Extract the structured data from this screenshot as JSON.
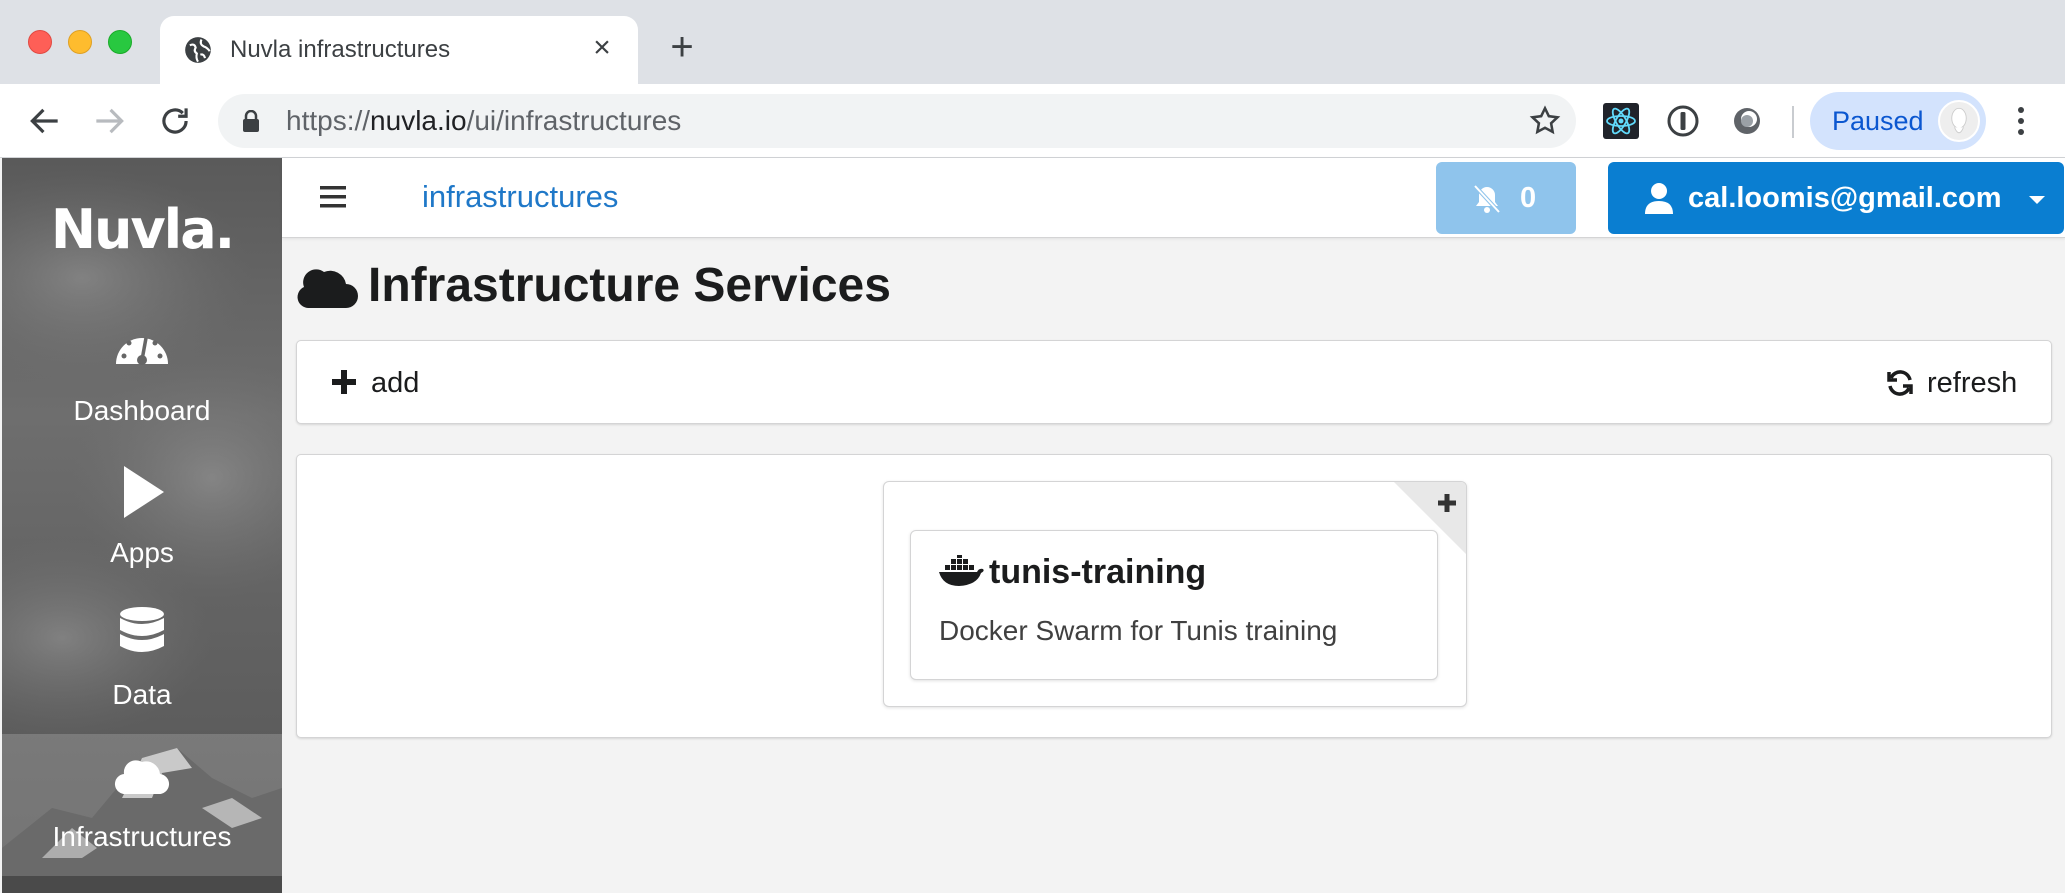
{
  "browser": {
    "tab_title": "Nuvla infrastructures",
    "url_scheme": "https://",
    "url_host": "nuvla.io",
    "url_path": "/ui/infrastructures",
    "profile_label": "Paused"
  },
  "app": {
    "logo": "Nuvla.",
    "sidebar": [
      {
        "label": "Dashboard",
        "icon": "gauge-icon"
      },
      {
        "label": "Apps",
        "icon": "play-icon"
      },
      {
        "label": "Data",
        "icon": "database-icon"
      },
      {
        "label": "Infrastructures",
        "icon": "cloud-icon",
        "active": true
      }
    ],
    "topbar": {
      "section_title": "infrastructures",
      "notification_count": "0",
      "user_email": "cal.loomis@gmail.com"
    },
    "page": {
      "title": "Infrastructure Services",
      "actions": {
        "add_label": "add",
        "refresh_label": "refresh"
      }
    },
    "services": [
      {
        "name": "tunis-training",
        "description": "Docker Swarm for Tunis training",
        "icon": "docker-icon"
      }
    ]
  },
  "colors": {
    "primary": "#0a7ed1",
    "notification": "#8fc4ec",
    "title_link": "#1f78c8"
  }
}
